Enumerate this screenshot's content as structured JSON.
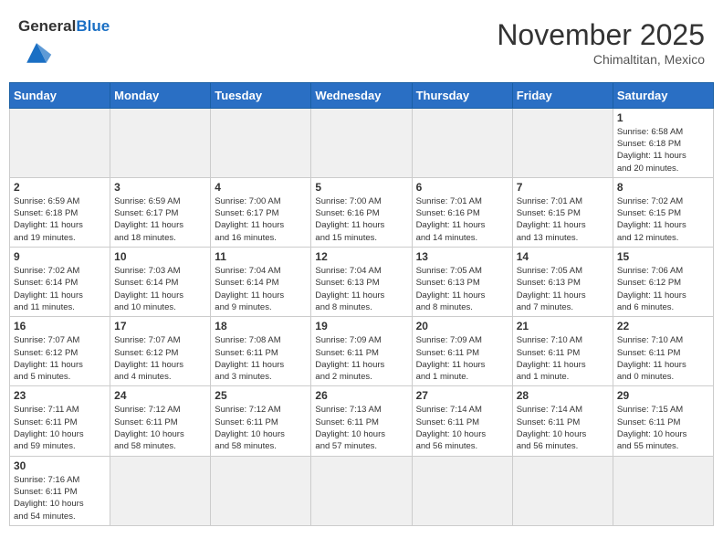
{
  "header": {
    "logo_general": "General",
    "logo_blue": "Blue",
    "month_year": "November 2025",
    "location": "Chimaltitan, Mexico"
  },
  "days_of_week": [
    "Sunday",
    "Monday",
    "Tuesday",
    "Wednesday",
    "Thursday",
    "Friday",
    "Saturday"
  ],
  "weeks": [
    [
      {
        "day": "",
        "info": ""
      },
      {
        "day": "",
        "info": ""
      },
      {
        "day": "",
        "info": ""
      },
      {
        "day": "",
        "info": ""
      },
      {
        "day": "",
        "info": ""
      },
      {
        "day": "",
        "info": ""
      },
      {
        "day": "1",
        "info": "Sunrise: 6:58 AM\nSunset: 6:18 PM\nDaylight: 11 hours\nand 20 minutes."
      }
    ],
    [
      {
        "day": "2",
        "info": "Sunrise: 6:59 AM\nSunset: 6:18 PM\nDaylight: 11 hours\nand 19 minutes."
      },
      {
        "day": "3",
        "info": "Sunrise: 6:59 AM\nSunset: 6:17 PM\nDaylight: 11 hours\nand 18 minutes."
      },
      {
        "day": "4",
        "info": "Sunrise: 7:00 AM\nSunset: 6:17 PM\nDaylight: 11 hours\nand 16 minutes."
      },
      {
        "day": "5",
        "info": "Sunrise: 7:00 AM\nSunset: 6:16 PM\nDaylight: 11 hours\nand 15 minutes."
      },
      {
        "day": "6",
        "info": "Sunrise: 7:01 AM\nSunset: 6:16 PM\nDaylight: 11 hours\nand 14 minutes."
      },
      {
        "day": "7",
        "info": "Sunrise: 7:01 AM\nSunset: 6:15 PM\nDaylight: 11 hours\nand 13 minutes."
      },
      {
        "day": "8",
        "info": "Sunrise: 7:02 AM\nSunset: 6:15 PM\nDaylight: 11 hours\nand 12 minutes."
      }
    ],
    [
      {
        "day": "9",
        "info": "Sunrise: 7:02 AM\nSunset: 6:14 PM\nDaylight: 11 hours\nand 11 minutes."
      },
      {
        "day": "10",
        "info": "Sunrise: 7:03 AM\nSunset: 6:14 PM\nDaylight: 11 hours\nand 10 minutes."
      },
      {
        "day": "11",
        "info": "Sunrise: 7:04 AM\nSunset: 6:14 PM\nDaylight: 11 hours\nand 9 minutes."
      },
      {
        "day": "12",
        "info": "Sunrise: 7:04 AM\nSunset: 6:13 PM\nDaylight: 11 hours\nand 8 minutes."
      },
      {
        "day": "13",
        "info": "Sunrise: 7:05 AM\nSunset: 6:13 PM\nDaylight: 11 hours\nand 8 minutes."
      },
      {
        "day": "14",
        "info": "Sunrise: 7:05 AM\nSunset: 6:13 PM\nDaylight: 11 hours\nand 7 minutes."
      },
      {
        "day": "15",
        "info": "Sunrise: 7:06 AM\nSunset: 6:12 PM\nDaylight: 11 hours\nand 6 minutes."
      }
    ],
    [
      {
        "day": "16",
        "info": "Sunrise: 7:07 AM\nSunset: 6:12 PM\nDaylight: 11 hours\nand 5 minutes."
      },
      {
        "day": "17",
        "info": "Sunrise: 7:07 AM\nSunset: 6:12 PM\nDaylight: 11 hours\nand 4 minutes."
      },
      {
        "day": "18",
        "info": "Sunrise: 7:08 AM\nSunset: 6:11 PM\nDaylight: 11 hours\nand 3 minutes."
      },
      {
        "day": "19",
        "info": "Sunrise: 7:09 AM\nSunset: 6:11 PM\nDaylight: 11 hours\nand 2 minutes."
      },
      {
        "day": "20",
        "info": "Sunrise: 7:09 AM\nSunset: 6:11 PM\nDaylight: 11 hours\nand 1 minute."
      },
      {
        "day": "21",
        "info": "Sunrise: 7:10 AM\nSunset: 6:11 PM\nDaylight: 11 hours\nand 1 minute."
      },
      {
        "day": "22",
        "info": "Sunrise: 7:10 AM\nSunset: 6:11 PM\nDaylight: 11 hours\nand 0 minutes."
      }
    ],
    [
      {
        "day": "23",
        "info": "Sunrise: 7:11 AM\nSunset: 6:11 PM\nDaylight: 10 hours\nand 59 minutes."
      },
      {
        "day": "24",
        "info": "Sunrise: 7:12 AM\nSunset: 6:11 PM\nDaylight: 10 hours\nand 58 minutes."
      },
      {
        "day": "25",
        "info": "Sunrise: 7:12 AM\nSunset: 6:11 PM\nDaylight: 10 hours\nand 58 minutes."
      },
      {
        "day": "26",
        "info": "Sunrise: 7:13 AM\nSunset: 6:11 PM\nDaylight: 10 hours\nand 57 minutes."
      },
      {
        "day": "27",
        "info": "Sunrise: 7:14 AM\nSunset: 6:11 PM\nDaylight: 10 hours\nand 56 minutes."
      },
      {
        "day": "28",
        "info": "Sunrise: 7:14 AM\nSunset: 6:11 PM\nDaylight: 10 hours\nand 56 minutes."
      },
      {
        "day": "29",
        "info": "Sunrise: 7:15 AM\nSunset: 6:11 PM\nDaylight: 10 hours\nand 55 minutes."
      }
    ],
    [
      {
        "day": "30",
        "info": "Sunrise: 7:16 AM\nSunset: 6:11 PM\nDaylight: 10 hours\nand 54 minutes."
      },
      {
        "day": "",
        "info": ""
      },
      {
        "day": "",
        "info": ""
      },
      {
        "day": "",
        "info": ""
      },
      {
        "day": "",
        "info": ""
      },
      {
        "day": "",
        "info": ""
      },
      {
        "day": "",
        "info": ""
      }
    ]
  ]
}
